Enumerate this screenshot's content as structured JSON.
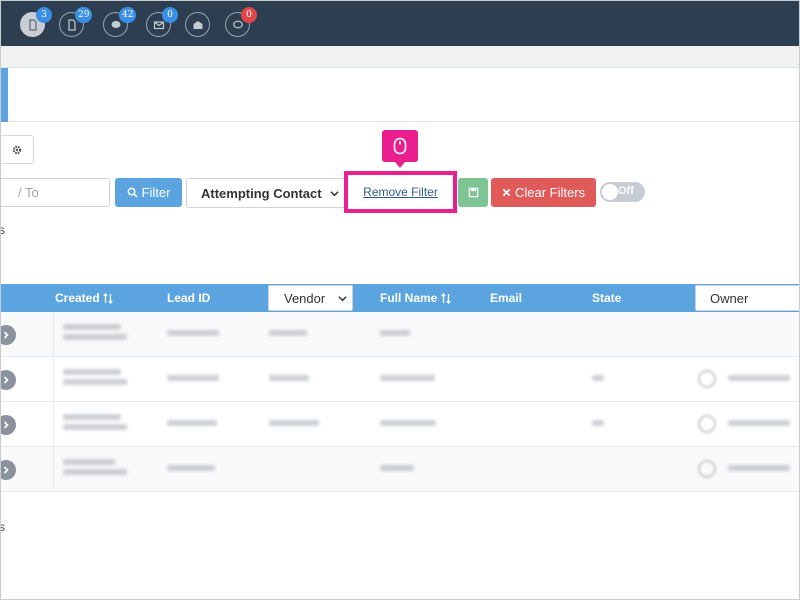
{
  "topbar": {
    "icons": [
      {
        "name": "document-icon",
        "badge": "3",
        "badge_color": "#3a8ee6"
      },
      {
        "name": "file-icon",
        "badge": "29",
        "badge_color": "#3a8ee6"
      },
      {
        "name": "chat-icon",
        "badge": "42",
        "badge_color": "#3a8ee6"
      },
      {
        "name": "mail-icon",
        "badge": "0",
        "badge_color": "#3a8ee6"
      },
      {
        "name": "mail-open-icon"
      },
      {
        "name": "speech-bubble-icon",
        "badge": "0",
        "badge_color": "#e04848"
      }
    ]
  },
  "filters": {
    "to_placeholder": "/ To",
    "filter_button": "Filter",
    "status_selected": "Attempting Contact",
    "remove_filter": "Remove Filter",
    "clear_filters": "Clear Filters",
    "toggle_label": "Off"
  },
  "edge_text": {
    "top": "s",
    "bottom": "s"
  },
  "table": {
    "columns": {
      "created": "Created",
      "lead_id": "Lead ID",
      "vendor": "Vendor",
      "full_name": "Full Name",
      "email": "Email",
      "state": "State",
      "owner": "Owner"
    }
  },
  "colors": {
    "topbar": "#2d3e50",
    "primary": "#5ba4e0",
    "danger": "#e05a5a",
    "success": "#7dc693",
    "highlight": "#ea1f8f"
  }
}
